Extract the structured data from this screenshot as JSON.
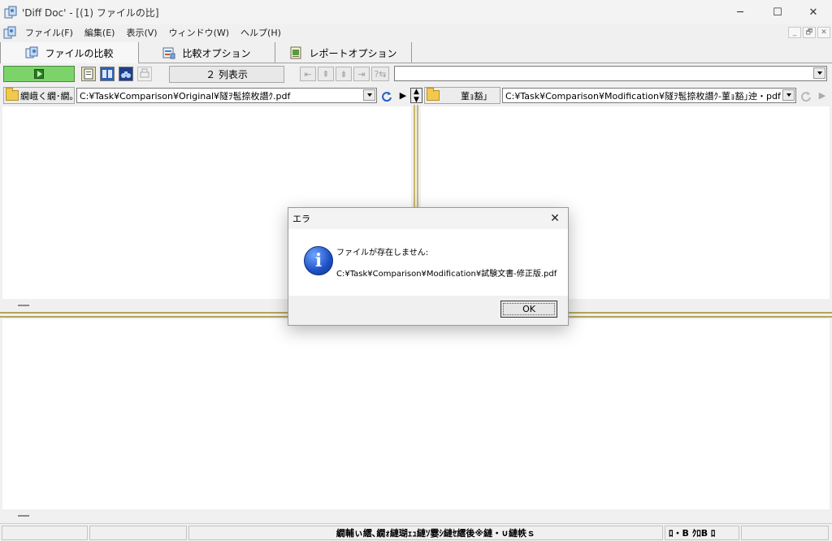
{
  "window": {
    "title": "'Diff Doc' - [(1) ファイルの比]",
    "minimize_glyph": "─",
    "maximize_glyph": "☐",
    "close_glyph": "✕",
    "icon": "diffdoc-app-icon"
  },
  "menu": {
    "items": [
      "ファイル(F)",
      "編集(E)",
      "表示(V)",
      "ウィンドウ(W)",
      "ヘルプ(H)"
    ],
    "mdi_minimize": "_",
    "mdi_restore": "🗗",
    "mdi_close": "✕"
  },
  "tabs": [
    {
      "label": "ファイルの比較",
      "icon": "compare-files-icon"
    },
    {
      "label": "比較オプション",
      "icon": "compare-options-icon"
    },
    {
      "label": "レポートオプション",
      "icon": "report-options-icon"
    }
  ],
  "toolbar": {
    "run_icon": "play-icon",
    "mode_label": "２ 列表示",
    "nav_glyphs": [
      "⇤",
      "⇞",
      "⇟",
      "⇥",
      "?⇆"
    ],
    "right_combo_value": ""
  },
  "paths": {
    "left_button_label": "繝峨く繝･繝｡繝ｳ繝",
    "left_path": "C:¥Task¥Comparison¥Original¥隧ｦ髢捺枚譖ｸ.pdf",
    "arrow_glyph": "▶",
    "right_button_label": "菫ｮ豁｣",
    "right_path": "C:¥Task¥Comparison¥Modification¥隧ｦ髢捺枚譖ｸ-菫ｮ豁｣迚・pdf"
  },
  "statusbar": {
    "center_text": "繝輔ぃ繧､繝ｫ縺瑚ｪｭ縺ｿ霎ｼ縺ｾ繧後※縺・∪縺帙ｓ",
    "right_text": "ﾛ・B ｸﾛB ﾛ"
  },
  "dialog": {
    "title": "エラ",
    "close_glyph": "✕",
    "icon_glyph": "i",
    "message_line1": "ファイルが存在しません:",
    "message_line2": "C:¥Task¥Comparison¥Modification¥試験文書-修正版.pdf",
    "ok_label": "OK"
  }
}
